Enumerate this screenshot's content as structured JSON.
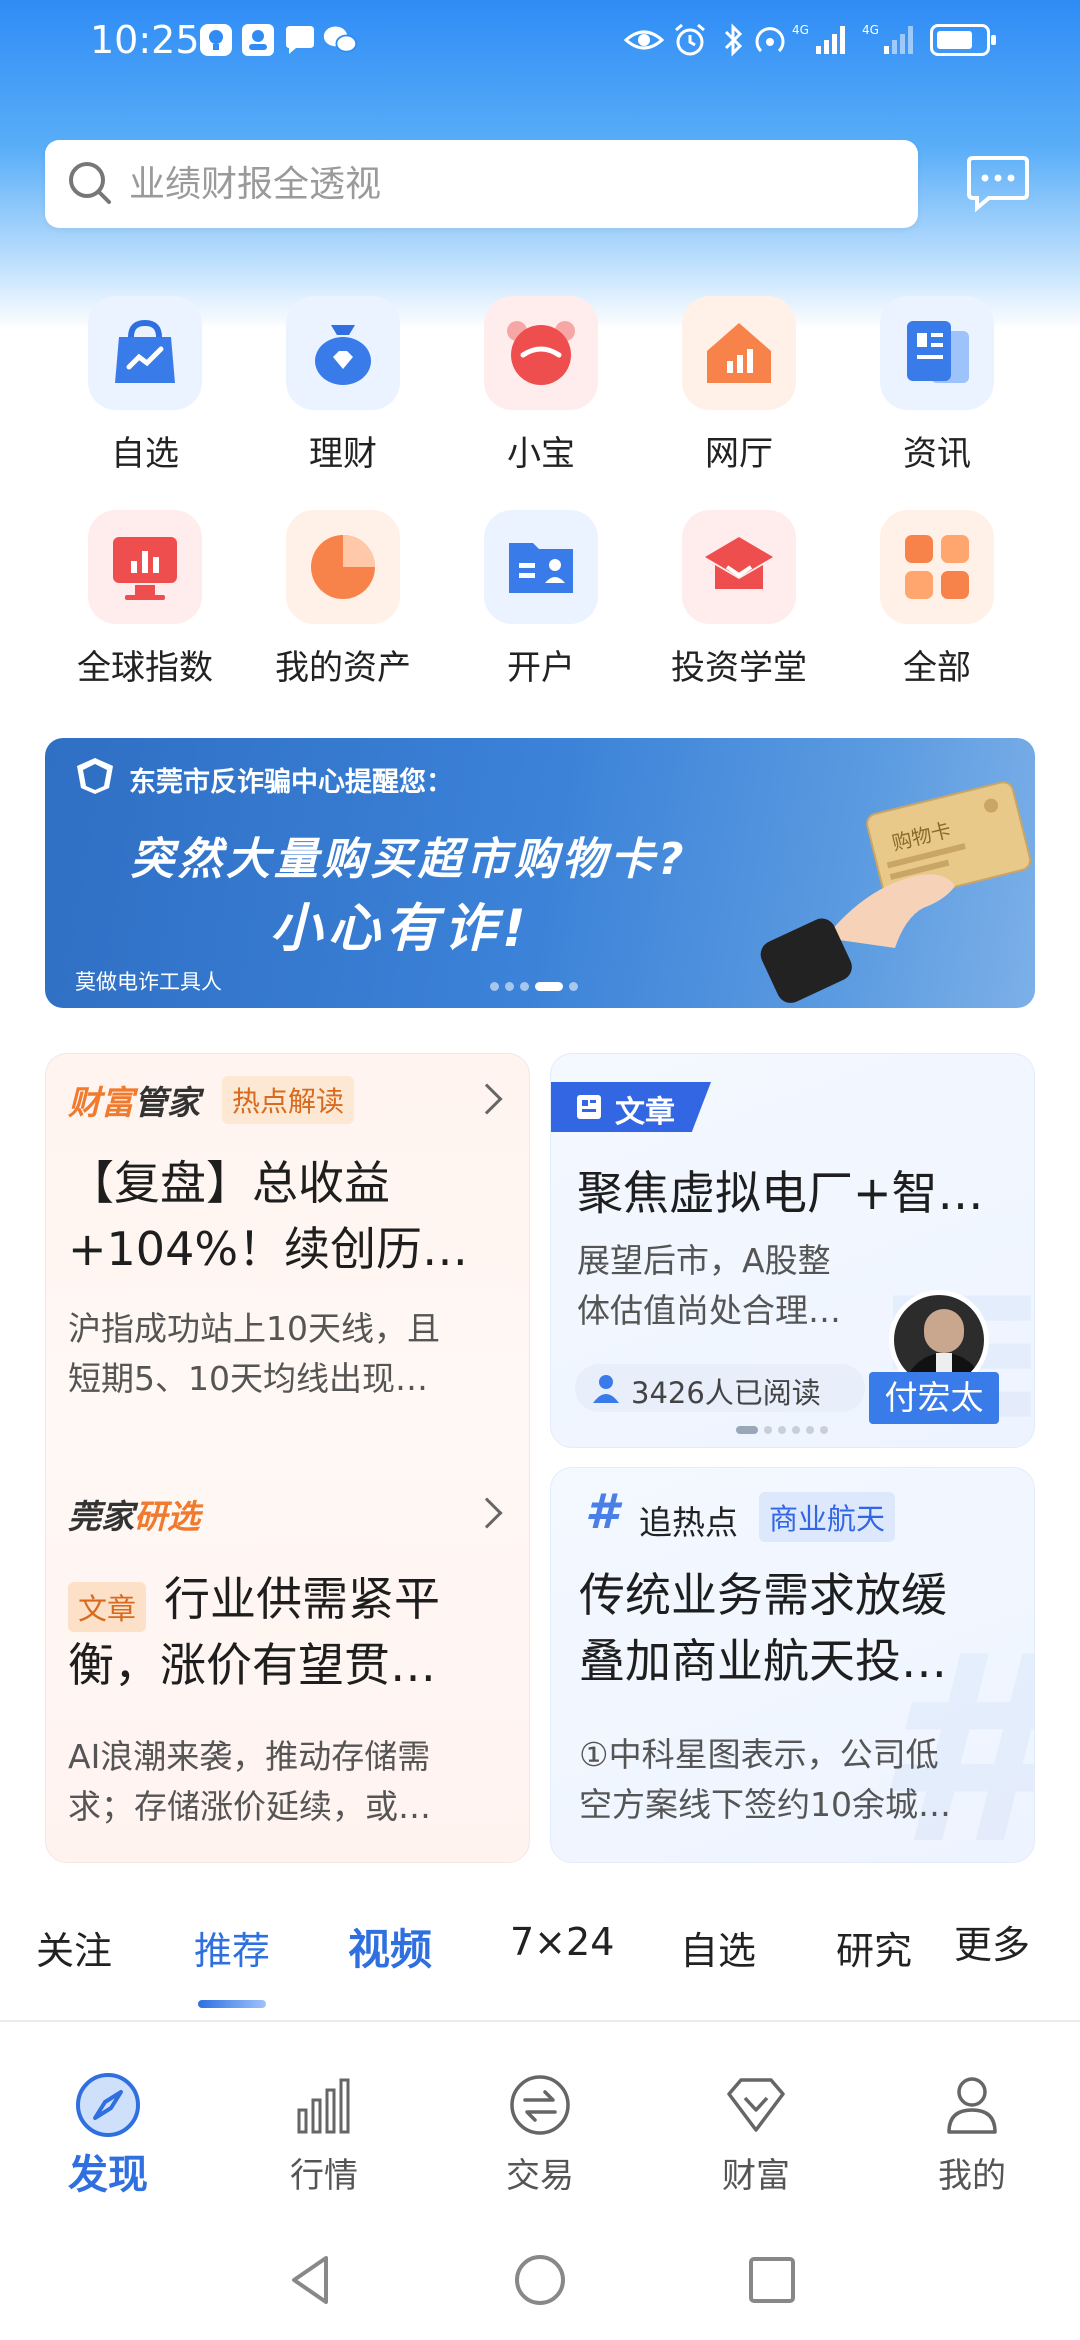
{
  "status_bar": {
    "time": "10:25",
    "battery_level": 0.75,
    "icons": [
      "lightbulb-icon",
      "app-icon",
      "chat-bubble-icon",
      "wechat-icon",
      "eye-icon",
      "alarm-icon",
      "bluetooth-icon",
      "hotspot-icon",
      "signal-4g-icon",
      "signal-4g-icon",
      "battery-icon"
    ]
  },
  "search": {
    "placeholder": "业绩财报全透视"
  },
  "grid": {
    "items": [
      {
        "label": "自选",
        "icon": "bag-chart-icon"
      },
      {
        "label": "理财",
        "icon": "money-pouch-icon"
      },
      {
        "label": "小宝",
        "icon": "mascot-icon"
      },
      {
        "label": "网厅",
        "icon": "house-chart-icon"
      },
      {
        "label": "资讯",
        "icon": "news-icon"
      },
      {
        "label": "全球指数",
        "icon": "monitor-chart-icon"
      },
      {
        "label": "我的资产",
        "icon": "pie-chart-icon"
      },
      {
        "label": "开户",
        "icon": "id-card-icon"
      },
      {
        "label": "投资学堂",
        "icon": "graduation-cap-icon"
      },
      {
        "label": "全部",
        "icon": "all-apps-icon"
      }
    ]
  },
  "banner": {
    "header": "东莞市反诈骗中心提醒您：",
    "line1": "突然大量购买超市购物卡?",
    "line2": "小心有诈!",
    "footer": "莫做电诈工具人",
    "card_text": "购物卡",
    "active_slide": 4,
    "slide_count": 5
  },
  "card_a": {
    "brand_part1": "财富",
    "brand_part2": "管家",
    "tag": "热点解读",
    "title": "【复盘】总收益+104%！续创历…",
    "title_line1": "【复盘】总收益",
    "title_line2": "+104%！续创历…",
    "desc_line1": "沪指成功站上10天线，且",
    "desc_line2": "短期5、10天均线出现…",
    "brand2_part1": "莞家",
    "brand2_part2": "研选",
    "tag2": "文章",
    "title2_line1": "行业供需紧平",
    "title2_line2": "衡，涨价有望贯…",
    "desc2_line1": "AI浪潮来袭，推动存储需",
    "desc2_line2": "求；存储涨价延续，或…"
  },
  "card_b": {
    "tab": "文章",
    "title": "聚焦虚拟电厂+智…",
    "desc_line1": "展望后市，A股整",
    "desc_line2": "体估值尚处合理…",
    "readers": "3426人已阅读",
    "author": "付宏太"
  },
  "card_c": {
    "tag_label": "追热点",
    "tag": "商业航天",
    "title_line1": "传统业务需求放缓",
    "title_line2": "叠加商业航天投…",
    "desc_line1": "①中科星图表示，公司低",
    "desc_line2": "空方案线下签约10余城…"
  },
  "news_tabs": [
    "关注",
    "推荐",
    "视频",
    "7×24",
    "自选",
    "研究",
    "更多"
  ],
  "bottom_nav": [
    {
      "label": "发现",
      "icon": "compass-icon"
    },
    {
      "label": "行情",
      "icon": "bar-chart-icon"
    },
    {
      "label": "交易",
      "icon": "exchange-icon"
    },
    {
      "label": "财富",
      "icon": "diamond-icon"
    },
    {
      "label": "我的",
      "icon": "user-icon"
    }
  ],
  "colors": {
    "accent": "#2f6fe0",
    "banner": "#3b82d8",
    "brand_orange": "#f07a2e"
  }
}
